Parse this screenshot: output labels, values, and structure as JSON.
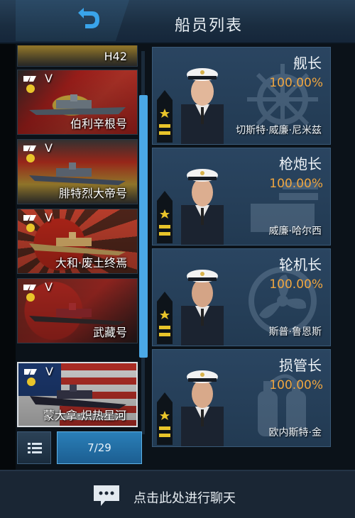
{
  "header": {
    "title": "船员列表"
  },
  "ships": [
    {
      "tier": "",
      "name": "H42",
      "flag": "flag-de2"
    },
    {
      "tier": "V",
      "name": "伯利辛根号",
      "flag": "flag-de"
    },
    {
      "tier": "V",
      "name": "腓特烈大帝号",
      "flag": "flag-de2"
    },
    {
      "tier": "V",
      "name": "大和·废土终焉",
      "flag": "flag-jp"
    },
    {
      "tier": "V",
      "name": "武藏号",
      "flag": "flag-jp2"
    },
    {
      "tier": "V",
      "name": "蒙大拿·炽热星河",
      "flag": "flag-us"
    }
  ],
  "pager": {
    "label": "7/29"
  },
  "crew": [
    {
      "role": "舰长",
      "percent": "100.00%",
      "name": "切斯特·威廉·尼米兹",
      "bg_icon": "ship-wheel-icon"
    },
    {
      "role": "枪炮长",
      "percent": "100.00%",
      "name": "威廉·哈尔西",
      "bg_icon": "turret-icon"
    },
    {
      "role": "轮机长",
      "percent": "100.00%",
      "name": "斯普·鲁恩斯",
      "bg_icon": "propeller-icon"
    },
    {
      "role": "损管长",
      "percent": "100.00%",
      "name": "欧内斯特·金",
      "bg_icon": "extinguisher-icon"
    }
  ],
  "chat": {
    "label": "点击此处进行聊天"
  },
  "colors": {
    "accent": "#4aa8e6",
    "percent": "#f0a640",
    "panel": "#223a52"
  }
}
